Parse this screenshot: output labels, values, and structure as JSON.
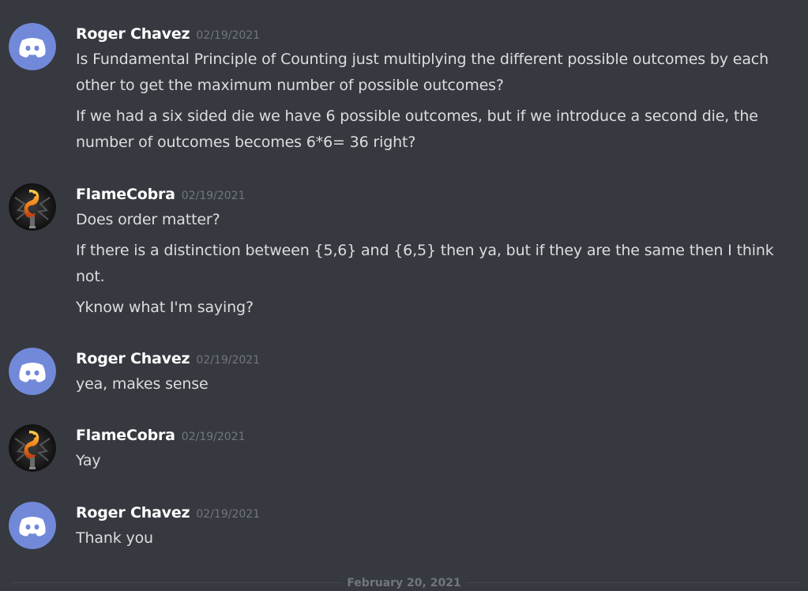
{
  "colors": {
    "background": "#36393f",
    "discord_avatar_bg": "#7289da",
    "username": "#ffffff",
    "message_text": "#dcddde",
    "timestamp": "#72767d"
  },
  "messages": [
    {
      "author": "Roger Chavez",
      "timestamp": "02/19/2021",
      "avatar": "discord-default-avatar",
      "lines": [
        "Is Fundamental Principle of Counting just multiplying the different possible outcomes by each other to get the maximum number of possible outcomes?",
        "If we had a six sided die we have 6 possible outcomes, but if we introduce a second die, the number of outcomes becomes 6*6= 36 right?"
      ]
    },
    {
      "author": "FlameCobra",
      "timestamp": "02/19/2021",
      "avatar": "flame-cobra-avatar",
      "lines": [
        "Does order matter?",
        "If there is a distinction between {5,6} and {6,5} then ya, but if they are the same then I think not.",
        "Yknow what I'm saying?"
      ]
    },
    {
      "author": "Roger Chavez",
      "timestamp": "02/19/2021",
      "avatar": "discord-default-avatar",
      "lines": [
        "yea, makes sense"
      ]
    },
    {
      "author": "FlameCobra",
      "timestamp": "02/19/2021",
      "avatar": "flame-cobra-avatar",
      "lines": [
        "Yay"
      ]
    },
    {
      "author": "Roger Chavez",
      "timestamp": "02/19/2021",
      "avatar": "discord-default-avatar",
      "lines": [
        "Thank you"
      ]
    }
  ],
  "date_divider": "February 20, 2021"
}
